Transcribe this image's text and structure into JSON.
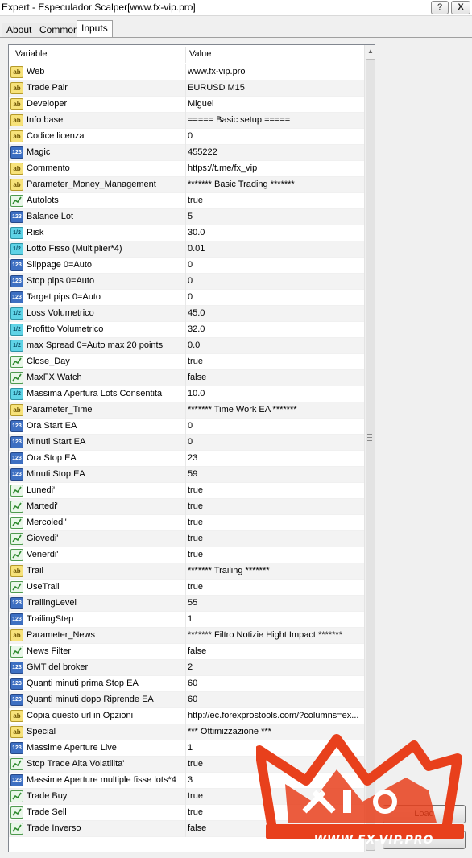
{
  "window": {
    "title": "Expert - Especulador Scalper[www.fx-vip.pro]",
    "help_label": "?",
    "close_label": "X"
  },
  "tabs": [
    {
      "label": "About"
    },
    {
      "label": "Common"
    },
    {
      "label": "Inputs"
    }
  ],
  "table": {
    "headers": {
      "variable": "Variable",
      "value": "Value"
    },
    "rows": [
      {
        "type": "string",
        "variable": "Web",
        "value": "www.fx-vip.pro"
      },
      {
        "type": "string",
        "variable": "Trade Pair",
        "value": " EURUSD M15"
      },
      {
        "type": "string",
        "variable": "Developer",
        "value": "Miguel"
      },
      {
        "type": "string",
        "variable": "Info base",
        "value": "===== Basic setup ====="
      },
      {
        "type": "string",
        "variable": "Codice licenza",
        "value": "0"
      },
      {
        "type": "int",
        "variable": "Magic",
        "value": "455222"
      },
      {
        "type": "string",
        "variable": "Commento",
        "value": "https://t.me/fx_vip"
      },
      {
        "type": "string",
        "variable": "Parameter_Money_Management",
        "value": "******* Basic Trading *******"
      },
      {
        "type": "bool",
        "variable": "Autolots",
        "value": "true"
      },
      {
        "type": "int",
        "variable": "Balance Lot",
        "value": "5"
      },
      {
        "type": "double",
        "variable": "Risk",
        "value": "30.0"
      },
      {
        "type": "double",
        "variable": "Lotto Fisso (Multiplier*4)",
        "value": "0.01"
      },
      {
        "type": "int",
        "variable": "Slippage 0=Auto",
        "value": "0"
      },
      {
        "type": "int",
        "variable": "Stop pips  0=Auto",
        "value": "0"
      },
      {
        "type": "int",
        "variable": "Target pips  0=Auto",
        "value": "0"
      },
      {
        "type": "double",
        "variable": "Loss Volumetrico",
        "value": "45.0"
      },
      {
        "type": "double",
        "variable": "Profitto Volumetrico",
        "value": "32.0"
      },
      {
        "type": "double",
        "variable": "max Spread  0=Auto max 20 points",
        "value": "0.0"
      },
      {
        "type": "bool",
        "variable": "Close_Day",
        "value": "true"
      },
      {
        "type": "bool",
        "variable": "MaxFX Watch",
        "value": "false"
      },
      {
        "type": "double",
        "variable": "Massima Apertura Lots Consentita",
        "value": "10.0"
      },
      {
        "type": "string",
        "variable": "Parameter_Time",
        "value": "******* Time Work EA *******"
      },
      {
        "type": "int",
        "variable": "Ora Start EA",
        "value": "0"
      },
      {
        "type": "int",
        "variable": "Minuti Start EA",
        "value": "0"
      },
      {
        "type": "int",
        "variable": "Ora Stop EA",
        "value": "23"
      },
      {
        "type": "int",
        "variable": "Minuti Stop EA",
        "value": "59"
      },
      {
        "type": "bool",
        "variable": "Lunedi'",
        "value": "true"
      },
      {
        "type": "bool",
        "variable": "Martedi'",
        "value": "true"
      },
      {
        "type": "bool",
        "variable": "Mercoledi'",
        "value": "true"
      },
      {
        "type": "bool",
        "variable": "Giovedi'",
        "value": "true"
      },
      {
        "type": "bool",
        "variable": "Venerdi'",
        "value": "true"
      },
      {
        "type": "string",
        "variable": "Trail",
        "value": "******* Trailing  *******"
      },
      {
        "type": "bool",
        "variable": "UseTrail",
        "value": "true"
      },
      {
        "type": "int",
        "variable": "TrailingLevel",
        "value": "55"
      },
      {
        "type": "int",
        "variable": "TrailingStep",
        "value": "1"
      },
      {
        "type": "string",
        "variable": "Parameter_News",
        "value": "******* Filtro Notizie Hight Impact  *******"
      },
      {
        "type": "bool",
        "variable": "News Filter",
        "value": "false"
      },
      {
        "type": "int",
        "variable": "GMT del broker",
        "value": "2"
      },
      {
        "type": "int",
        "variable": "Quanti minuti prima Stop EA",
        "value": "60"
      },
      {
        "type": "int",
        "variable": "Quanti minuti dopo Riprende EA",
        "value": "60"
      },
      {
        "type": "string",
        "variable": "Copia questo url in Opzioni",
        "value": "http://ec.forexprostools.com/?columns=ex..."
      },
      {
        "type": "string",
        "variable": "Special",
        "value": "*** Ottimizzazione ***"
      },
      {
        "type": "int",
        "variable": "Massime Aperture Live",
        "value": "1"
      },
      {
        "type": "bool",
        "variable": "Stop Trade Alta Volatilita'",
        "value": "true"
      },
      {
        "type": "int",
        "variable": "Massime Aperture multiple fisse lots*4",
        "value": "3"
      },
      {
        "type": "bool",
        "variable": "Trade Buy",
        "value": "true"
      },
      {
        "type": "bool",
        "variable": "Trade Sell",
        "value": "true"
      },
      {
        "type": "bool",
        "variable": "Trade Inverso",
        "value": "false"
      }
    ]
  },
  "type_icons": {
    "string": "ab",
    "int": "123",
    "double": "1/2"
  },
  "buttons": {
    "load": "Load",
    "save": ""
  },
  "watermark": {
    "text": "WWW.FX-VIP.PRO",
    "color": "#e8401c"
  }
}
